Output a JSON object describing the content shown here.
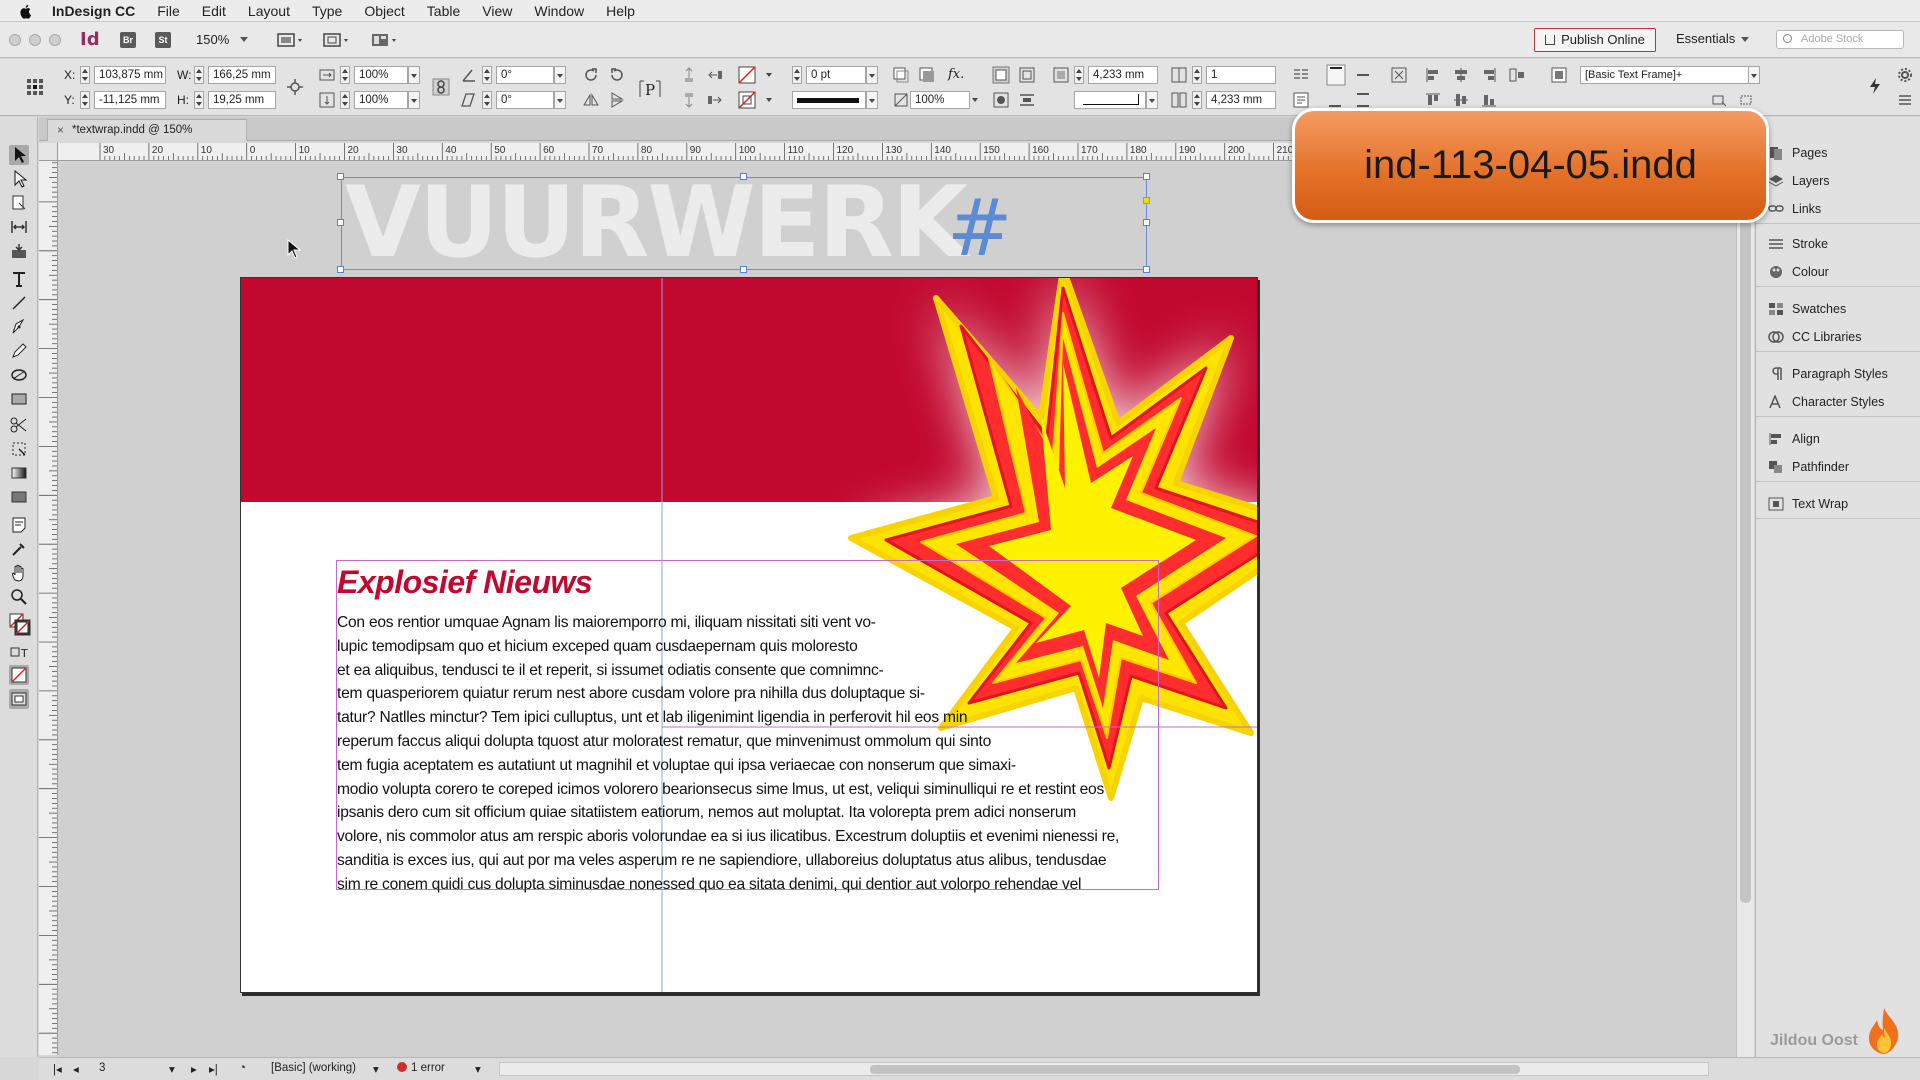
{
  "menubar": {
    "app_name": "InDesign CC",
    "items": [
      "File",
      "Edit",
      "Layout",
      "Type",
      "Object",
      "Table",
      "View",
      "Window",
      "Help"
    ]
  },
  "appbar": {
    "bridge_label": "Br",
    "stock_label": "St",
    "zoom": "150%",
    "publish_label": "Publish Online",
    "workspace": "Essentials",
    "search_placeholder": "Adobe Stock"
  },
  "control_panel": {
    "x_label": "X:",
    "x_value": "103,875 mm",
    "y_label": "Y:",
    "y_value": "-11,125 mm",
    "w_label": "W:",
    "w_value": "166,25 mm",
    "h_label": "H:",
    "h_value": "19,25 mm",
    "scale_x": "100%",
    "scale_y": "100%",
    "rotation": "0°",
    "shear": "0°",
    "stroke_weight": "0 pt",
    "opacity": "100%",
    "inset_1": "4,233 mm",
    "inset_2": "4,233 mm",
    "columns": "1",
    "object_style": "[Basic Text Frame]+"
  },
  "document": {
    "tab_title": "*textwrap.indd @ 150%",
    "title_text": "VUURWERK",
    "title_hash": "#",
    "headline": "Explosief Nieuws",
    "body_lines": [
      "Con eos rentior umquae Agnam lis maioremporro mi, iliquam nissitati siti vent vo-",
      "lupic temodipsam quo et hicium exceped quam cusdaepernam quis moloresto",
      "et ea aliquibus, tendusci te il et reperit, si issumet odiatis consente que comnimnc-",
      "tem quasperiorem quiatur rerum nest abore cusdam volore pra nihilla dus doluptaque si-",
      "tatur? Natlles minctur? Tem ipici culluptus, unt et lab iligenimint ligendia in perferovit hil eos min",
      "reperum faccus aliqui dolupta tquost atur moloratest rematur, que minvenimust ommolum qui sinto",
      "tem fugia aceptatem es autatiunt ut magnihil et voluptae qui ipsa veriaecae con nonserum que simaxi-",
      "modio volupta corero te coreped icimos volorero bearionsecus sime lmus, ut est, veliqui siminulliqui re et restint eos",
      "ipsanis dero cum sit officium quiae sitatiistem eatiorum, nemos aut moluptat. Ita volorepta prem adici nonserum",
      "volore, nis commolor atus am rerspic aboris volorundae ea si ius ilicatibus. Excestrum doluptiis et evenimi nienessi re,",
      "sanditia is exces ius, qui aut por ma veles asperum re ne sapiendiore, ullaboreius doluptatus atus alibus, tendusdae",
      "sim re conem quidi cus dolupta siminusdae nonessed quo ea sitata denimi, qui dentior aut volorpo rehendae vel"
    ],
    "ruler_labels": [
      "30",
      "20",
      "10",
      "0",
      "10",
      "20",
      "30",
      "40",
      "50",
      "60",
      "70",
      "80",
      "90",
      "100",
      "110",
      "120",
      "130",
      "140",
      "150",
      "160",
      "170",
      "180",
      "190",
      "200",
      "210"
    ]
  },
  "panels": {
    "group1": [
      "Pages",
      "Layers",
      "Links"
    ],
    "group2": [
      "Stroke",
      "Colour"
    ],
    "group3": [
      "Swatches",
      "CC Libraries"
    ],
    "group4": [
      "Paragraph Styles",
      "Character Styles"
    ],
    "group5": [
      "Align",
      "Pathfinder"
    ],
    "group6": [
      "Text Wrap"
    ]
  },
  "status": {
    "page_number": "3",
    "preflight_profile": "[Basic] (working)",
    "errors": "1 error"
  },
  "callout": {
    "filename": "ind-113-04-05.indd"
  },
  "watermark": {
    "text": "Jildou Oost"
  },
  "colors": {
    "brand_red": "#c2082f",
    "star_yellow": "#fff200",
    "callout_orange": "#e36f25",
    "frame_blue": "#5b7fd6",
    "text_frame_magenta": "#c36bd1"
  }
}
